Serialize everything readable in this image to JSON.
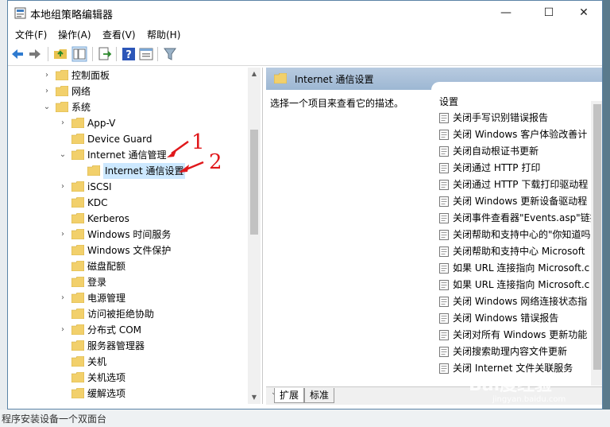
{
  "window": {
    "title": "本地组策略编辑器",
    "minimize": "—",
    "maximize": "☐",
    "close": "✕"
  },
  "menu": [
    "文件(F)",
    "操作(A)",
    "查看(V)",
    "帮助(H)"
  ],
  "toolbar": {
    "icons": [
      "back-arrow-icon",
      "forward-arrow-icon",
      "up-folder-icon",
      "show-hide-tree-icon",
      "export-list-icon",
      "help-icon",
      "properties-icon",
      "filter-icon"
    ]
  },
  "tree": [
    {
      "label": "控制面板",
      "arrow": "›"
    },
    {
      "label": "网络",
      "arrow": "›"
    },
    {
      "label": "系统",
      "arrow": "⌄"
    },
    {
      "label": "App-V",
      "arrow": "›"
    },
    {
      "label": "Device Guard",
      "arrow": ""
    },
    {
      "label": "Internet 通信管理",
      "arrow": "⌄"
    },
    {
      "label": "Internet 通信设置",
      "arrow": "",
      "selected": true
    },
    {
      "label": "iSCSI",
      "arrow": "›"
    },
    {
      "label": "KDC",
      "arrow": ""
    },
    {
      "label": "Kerberos",
      "arrow": ""
    },
    {
      "label": "Windows 时间服务",
      "arrow": "›"
    },
    {
      "label": "Windows 文件保护",
      "arrow": ""
    },
    {
      "label": "磁盘配额",
      "arrow": ""
    },
    {
      "label": "登录",
      "arrow": ""
    },
    {
      "label": "电源管理",
      "arrow": "›"
    },
    {
      "label": "访问被拒绝协助",
      "arrow": ""
    },
    {
      "label": "分布式 COM",
      "arrow": "›"
    },
    {
      "label": "服务器管理器",
      "arrow": ""
    },
    {
      "label": "关机",
      "arrow": ""
    },
    {
      "label": "关机选项",
      "arrow": ""
    },
    {
      "label": "缓解选项",
      "arrow": ""
    }
  ],
  "right": {
    "header": "Internet 通信设置",
    "description": "选择一个项目来查看它的描述。",
    "list_header": "设置",
    "items": [
      "关闭手写识别错误报告",
      "关闭 Windows 客户体验改善计",
      "关闭自动根证书更新",
      "关闭通过 HTTP 打印",
      "关闭通过 HTTP 下载打印驱动程",
      "关闭 Windows 更新设备驱动程",
      "关闭事件查看器\"Events.asp\"链接",
      "关闭帮助和支持中心的\"你知道吗",
      "关闭帮助和支持中心 Microsoft",
      "如果 URL 连接指向 Microsoft.c",
      "如果 URL 连接指向 Microsoft.c",
      "关闭 Windows 网络连接状态指",
      "关闭 Windows 错误报告",
      "关闭对所有 Windows 更新功能",
      "关闭搜索助理内容文件更新",
      "关闭 Internet 文件关联服务"
    ],
    "tabs": [
      "扩展",
      "标准"
    ]
  },
  "annotations": {
    "one": "1",
    "two": "2"
  },
  "background": {
    "bottom_text": "程序安装设备一个双面台",
    "watermark": "Bai度经验",
    "watermark_url": "jingyan.baidu.com"
  },
  "colors": {
    "accent": "#cce8ff",
    "arrow_red": "#e0181b",
    "folder": "#f2d06b"
  }
}
